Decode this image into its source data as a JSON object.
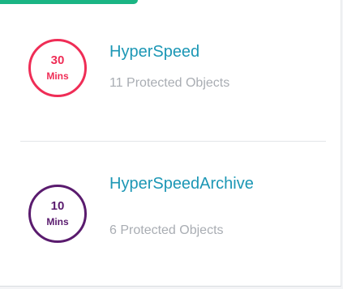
{
  "theme": {
    "accent": "#1bb584",
    "name_color": "#1c97b5",
    "sub_color": "#a9adb3"
  },
  "items": [
    {
      "sla_value": "30",
      "sla_unit": "Mins",
      "name": "HyperSpeed",
      "protected_objects": "11 Protected Objects",
      "color": "#ef2d56"
    },
    {
      "sla_value": "10",
      "sla_unit": "Mins",
      "name": "HyperSpeedArchive",
      "protected_objects": "6 Protected Objects",
      "color": "#5a1b6e"
    }
  ]
}
